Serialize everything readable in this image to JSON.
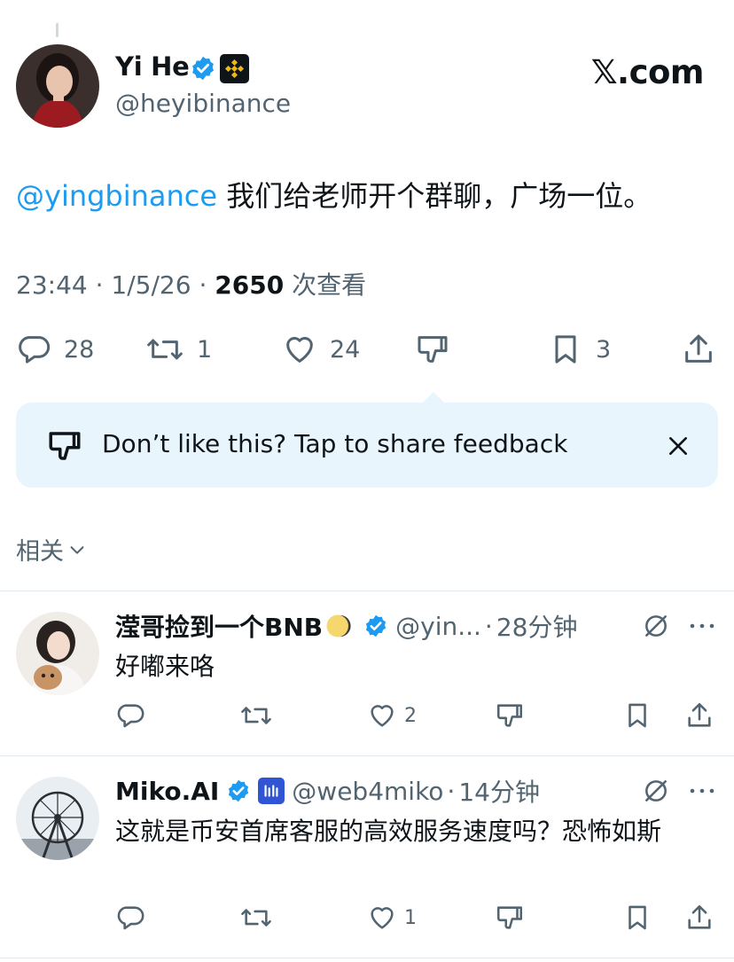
{
  "tweet": {
    "author_name": "Yi He",
    "author_handle": "@heyibinance",
    "mention": "@yingbinance",
    "text": " 我们给老师开个群聊，广场一位。",
    "time": "23:44",
    "date": "1/5/26",
    "views_count": "2650",
    "views_label": "次查看",
    "stats": {
      "replies": "28",
      "retweets": "1",
      "likes": "24",
      "bookmarks": "3"
    }
  },
  "brand": {
    "site": "𝕏.com"
  },
  "feedback": {
    "text": "Don’t like this? Tap to share feedback"
  },
  "related": {
    "label": "相关"
  },
  "replies": [
    {
      "name": "滢哥捡到一个BNB",
      "handle": "@yin...",
      "time": "28分钟",
      "text": "好嘟来咯",
      "likes": "2"
    },
    {
      "name": "Miko.AI",
      "handle": "@web4miko",
      "time": "14分钟",
      "text": "这就是币安首席客服的高效服务速度吗？恐怖如斯",
      "likes": "1"
    }
  ],
  "colors": {
    "accent": "#1d9bf0",
    "muted": "#536471",
    "feedback_bg": "#e8f5fd",
    "binance_gold": "#f0b90b"
  }
}
